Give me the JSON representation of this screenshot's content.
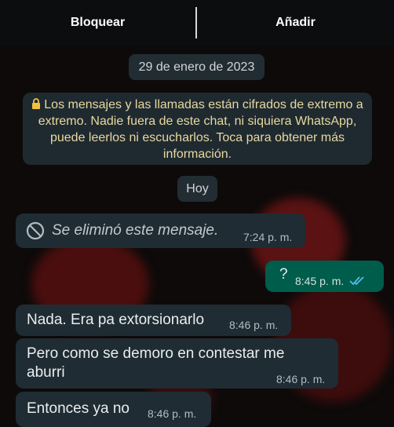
{
  "topbar": {
    "block_label": "Bloquear",
    "add_label": "Añadir"
  },
  "chat": {
    "date_chip": "29 de enero de 2023",
    "encryption_notice": "Los mensajes y las llamadas están cifrados de extremo a extremo. Nadie fuera de este chat, ni siquiera WhatsApp, puede leerlos ni escucharlos. Toca para obtener más información.",
    "today_chip": "Hoy",
    "messages": [
      {
        "direction": "in",
        "text": "Se eliminó este mensaje.",
        "time": "7:24 p. m.",
        "deleted": true
      },
      {
        "direction": "out",
        "text": "?",
        "time": "8:45 p. m.",
        "status": "read"
      },
      {
        "direction": "in",
        "text": "Nada. Era pa extorsionarlo",
        "time": "8:46 p. m."
      },
      {
        "direction": "in",
        "text": "Pero como se demoro en contestar me aburri",
        "time": "8:46 p. m."
      },
      {
        "direction": "in",
        "text": "Entonces ya no",
        "time": "8:46 p. m."
      }
    ]
  },
  "colors": {
    "incoming": "#1f2c33",
    "outgoing": "#005c4b",
    "ticks": "#53bdeb",
    "lock": "#f0c040"
  },
  "icons": {
    "lock": "lock-icon",
    "deleted": "blocked-circle-icon",
    "read": "double-check-icon"
  }
}
